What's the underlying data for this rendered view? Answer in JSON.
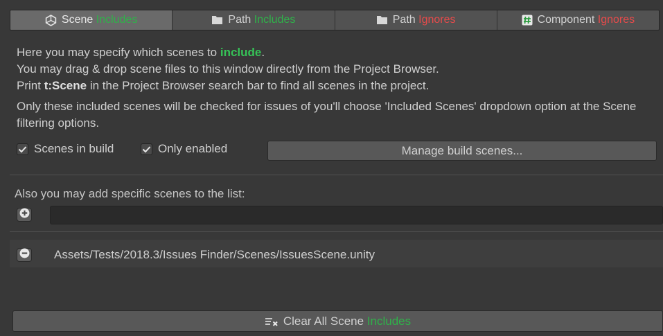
{
  "tabs": [
    {
      "label": "Scene",
      "suffix": "Includes",
      "suffix_color": "green",
      "icon": "unity-scene-icon",
      "active": true
    },
    {
      "label": "Path",
      "suffix": "Includes",
      "suffix_color": "green",
      "icon": "folder-icon",
      "active": false
    },
    {
      "label": "Path",
      "suffix": "Ignores",
      "suffix_color": "red",
      "icon": "folder-icon",
      "active": false
    },
    {
      "label": "Component",
      "suffix": "Ignores",
      "suffix_color": "red",
      "icon": "hash-icon",
      "active": false
    }
  ],
  "info": {
    "line1_prefix": "Here you may specify which scenes to ",
    "line1_highlight": "include",
    "line1_suffix": ".",
    "line2": "You may drag & drop scene files to this window directly from the Project Browser.",
    "line3_prefix": "Print ",
    "line3_bold": "t:Scene",
    "line3_suffix": " in the Project Browser search bar to find all scenes in the project.",
    "line4": "Only these included scenes will be checked for issues of you'll choose 'Included Scenes' dropdown option at the Scene filtering options."
  },
  "toggles": {
    "scenes_in_build": {
      "label": "Scenes in build",
      "checked": true
    },
    "only_enabled": {
      "label": "Only enabled",
      "checked": true
    }
  },
  "manage_button": "Manage build scenes...",
  "also_label": "Also you may add specific scenes to the list:",
  "path_input": {
    "value": "",
    "placeholder": ""
  },
  "scene_list": [
    {
      "path": "Assets/Tests/2018.3/Issues Finder/Scenes/IssuesScene.unity"
    }
  ],
  "clear_button": {
    "prefix": "Clear All Scene ",
    "highlight": "Includes"
  },
  "colors": {
    "green": "#2fb24a",
    "red": "#e64b4b",
    "background": "#383838"
  }
}
